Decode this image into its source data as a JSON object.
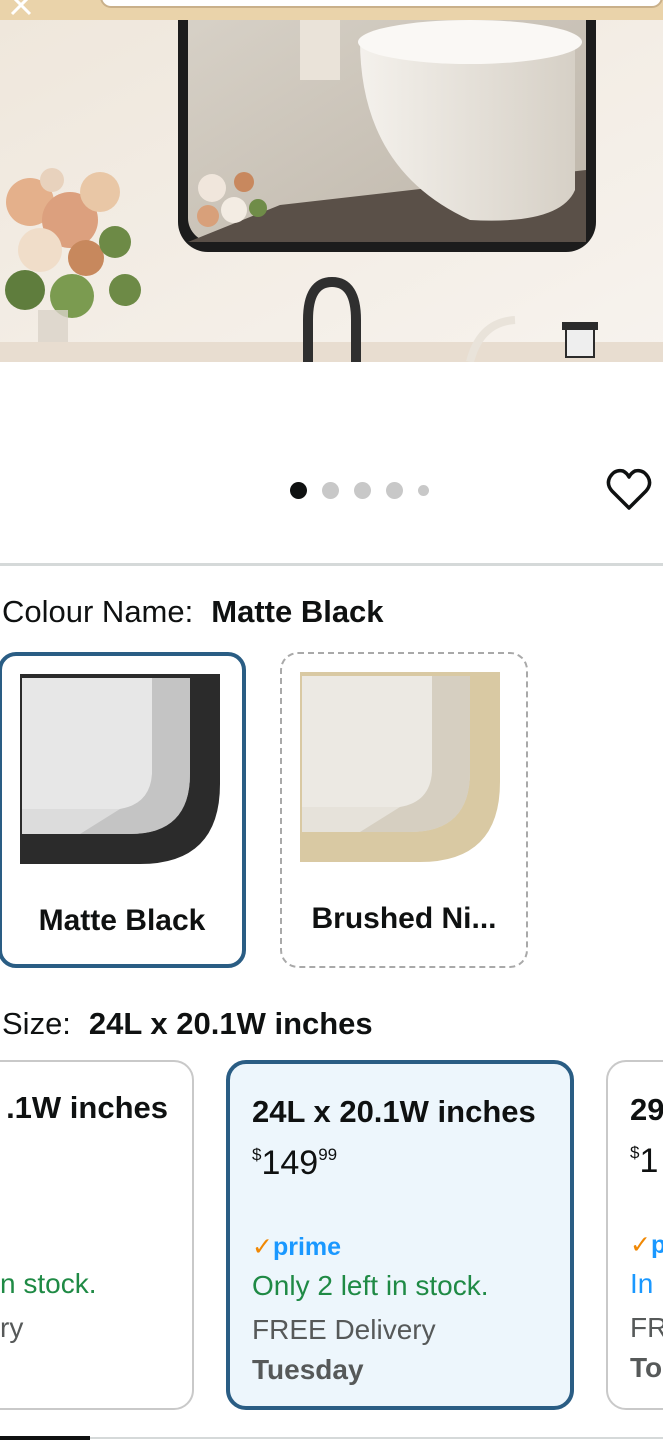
{
  "gallery": {
    "image_count": 5,
    "active_index": 0,
    "favourite_icon": "heart-outline-icon",
    "close_icon": "close-icon"
  },
  "colour": {
    "label": "Colour Name:",
    "selected_value": "Matte Black",
    "options": [
      {
        "name": "Matte Black",
        "selected": true,
        "frame_color": "#2b2b2b"
      },
      {
        "name": "Brushed Ni...",
        "selected": false,
        "frame_color": "#d9c9a3"
      }
    ]
  },
  "size": {
    "label": "Size:",
    "selected_value": "24L x 20.1W inches",
    "options": [
      {
        "title": ".1W inches",
        "stock": "n stock.",
        "delivery": "ry"
      },
      {
        "title": "24L x 20.1W inches",
        "price_symbol": "$",
        "price_whole": "149",
        "price_fraction": "99",
        "prime": "prime",
        "stock": "Only 2 left in stock.",
        "delivery": "FREE Delivery",
        "day": "Tuesday",
        "selected": true
      },
      {
        "title": "29",
        "price_symbol": "$",
        "price_whole": "1",
        "prime": "p",
        "stock": "In",
        "delivery": "FR",
        "day": "To"
      }
    ]
  },
  "colors": {
    "selected_border": "#2a5d84",
    "selected_fill": "#edf6fc",
    "in_stock": "#1f8a45",
    "prime_blue": "#1a98ff",
    "prime_check": "#f08804"
  }
}
